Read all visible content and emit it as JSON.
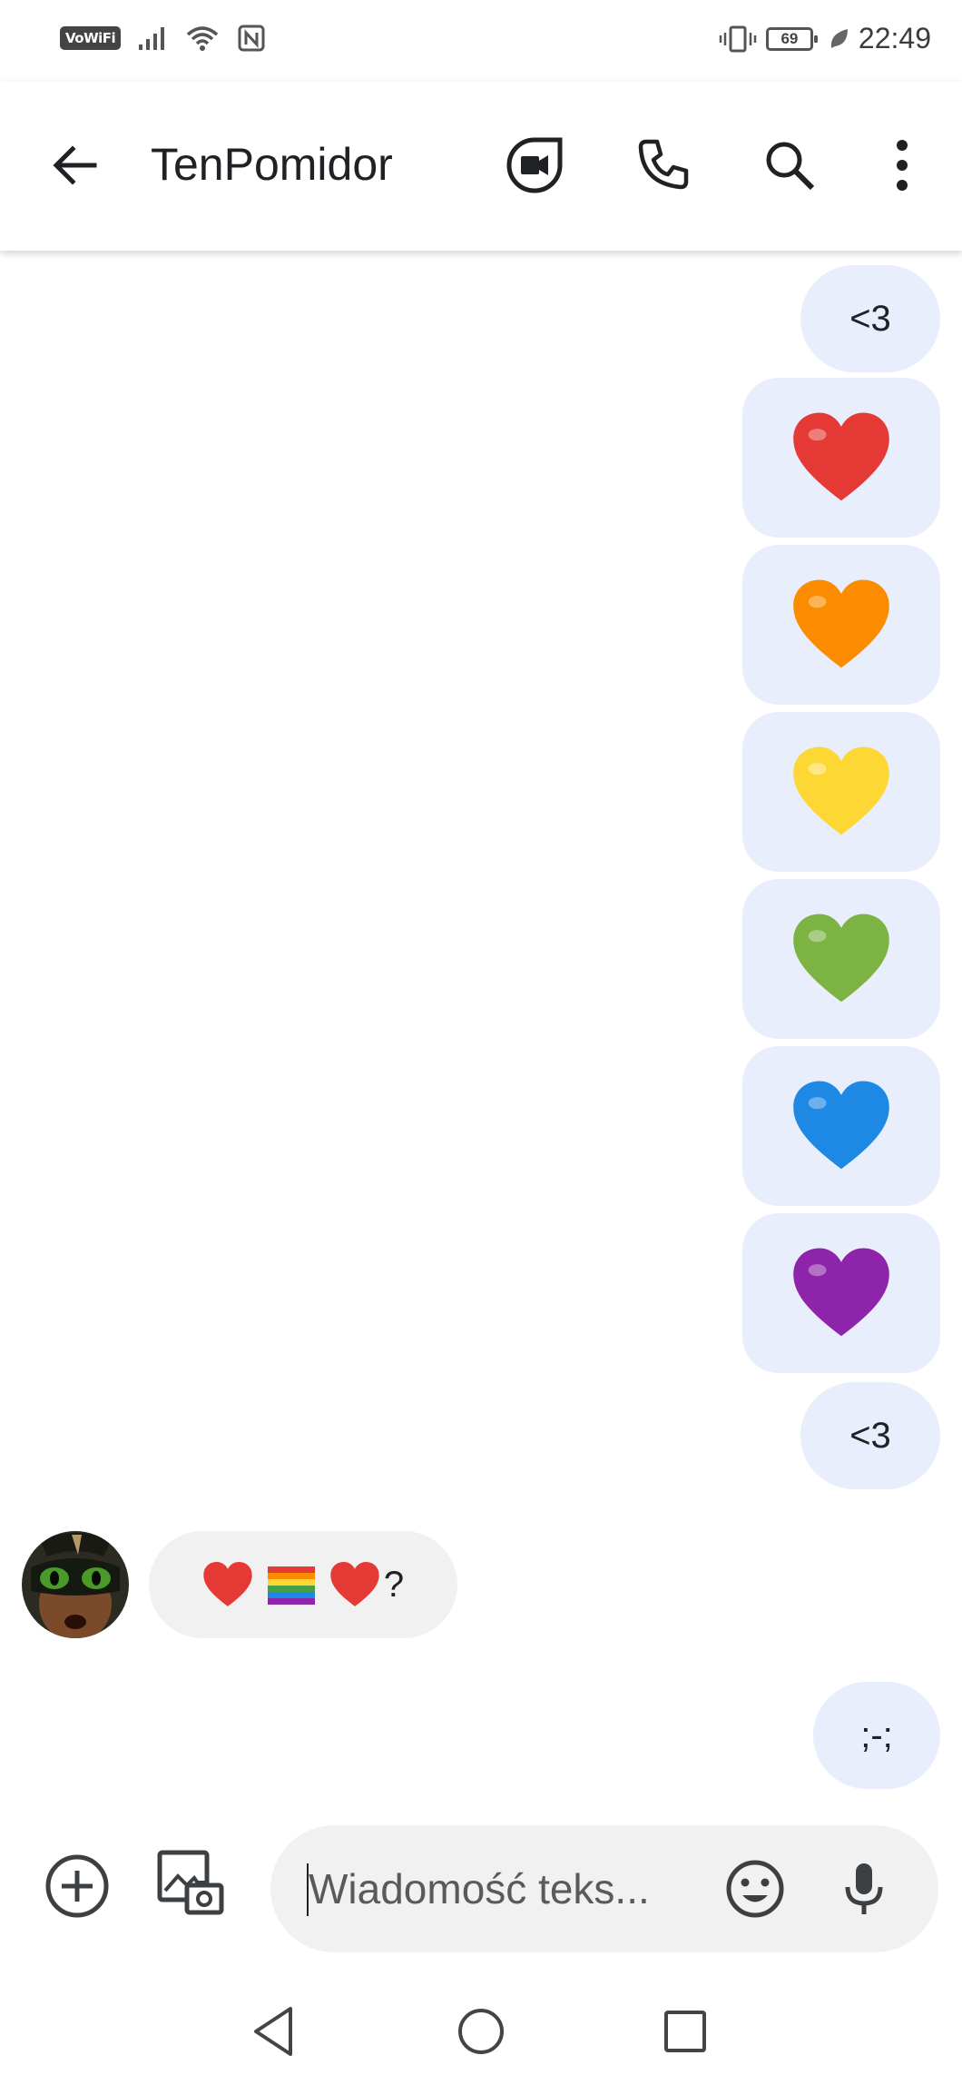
{
  "status_bar": {
    "vowifi": "VoWiFi",
    "battery": "69",
    "time": "22:49"
  },
  "app_bar": {
    "title": "TenPomidor",
    "icons": [
      "back-arrow-icon",
      "video-call-icon",
      "phone-icon",
      "search-icon",
      "more-vert-icon"
    ]
  },
  "messages": [
    {
      "direction": "outgoing",
      "text": "<3"
    },
    {
      "direction": "outgoing",
      "emoji": "red-heart",
      "color": "#e53935"
    },
    {
      "direction": "outgoing",
      "emoji": "orange-heart",
      "color": "#fb8c00"
    },
    {
      "direction": "outgoing",
      "emoji": "yellow-heart",
      "color": "#fdd835"
    },
    {
      "direction": "outgoing",
      "emoji": "green-heart",
      "color": "#7cb342"
    },
    {
      "direction": "outgoing",
      "emoji": "blue-heart",
      "color": "#1e88e5"
    },
    {
      "direction": "outgoing",
      "emoji": "purple-heart",
      "color": "#8e24aa"
    },
    {
      "direction": "outgoing",
      "text": "<3"
    },
    {
      "direction": "incoming",
      "text_suffix": "?",
      "emoji": [
        "red-heart",
        "rainbow-flag",
        "red-heart"
      ]
    },
    {
      "direction": "outgoing",
      "text": ";-;"
    }
  ],
  "compose": {
    "placeholder": "Wiadomość teks..."
  },
  "colors": {
    "outgoing_bubble": "#e8eefb",
    "incoming_bubble": "#f1f1f1"
  }
}
